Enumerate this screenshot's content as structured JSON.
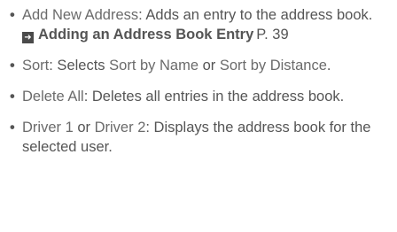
{
  "items": [
    {
      "term": "Add New Address",
      "desc": ": Adds an entry to the address book.",
      "ref": {
        "title": "Adding an Address Book Entry",
        "page": "P. 39"
      }
    },
    {
      "term1": "Sort",
      "desc1": ": Selects ",
      "term2": "Sort by Name",
      "desc2": " or ",
      "term3": "Sort by Distance",
      "desc3": "."
    },
    {
      "term": "Delete All",
      "desc": ": Deletes all entries in the address book."
    },
    {
      "term1": "Driver 1",
      "desc1": " or ",
      "term2": "Driver 2",
      "desc2": ": Displays the address book for the selected user."
    }
  ],
  "icons": {
    "reference_arrow": "reference-arrow-icon"
  }
}
